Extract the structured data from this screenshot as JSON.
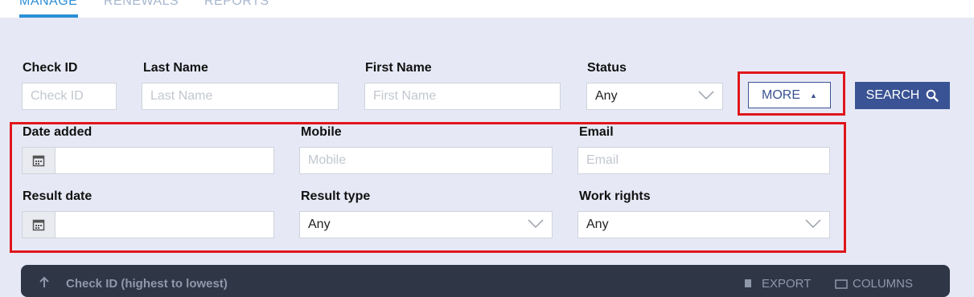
{
  "tabs": [
    {
      "label": "MANAGE",
      "active": true
    },
    {
      "label": "RENEWALS",
      "active": false
    },
    {
      "label": "REPORTS",
      "active": false
    }
  ],
  "search": {
    "check_id": {
      "label": "Check ID",
      "placeholder": "Check ID"
    },
    "last_name": {
      "label": "Last Name",
      "placeholder": "Last Name"
    },
    "first_name": {
      "label": "First Name",
      "placeholder": "First Name"
    },
    "status": {
      "label": "Status",
      "value": "Any"
    },
    "more_label": "MORE",
    "search_label": "SEARCH"
  },
  "more_filters": {
    "date_added": {
      "label": "Date added"
    },
    "mobile": {
      "label": "Mobile",
      "placeholder": "Mobile"
    },
    "email": {
      "label": "Email",
      "placeholder": "Email"
    },
    "result_date": {
      "label": "Result date"
    },
    "result_type": {
      "label": "Result type",
      "value": "Any"
    },
    "work_rights": {
      "label": "Work rights",
      "value": "Any"
    }
  },
  "results_bar": {
    "sort_label": "Check ID (highest to lowest)",
    "export_label": "EXPORT",
    "columns_label": "COLUMNS"
  },
  "colors": {
    "accent": "#3a5394",
    "tab_active": "#2b8fd6",
    "highlight": "#e0161c",
    "background": "#e6e9f5"
  }
}
